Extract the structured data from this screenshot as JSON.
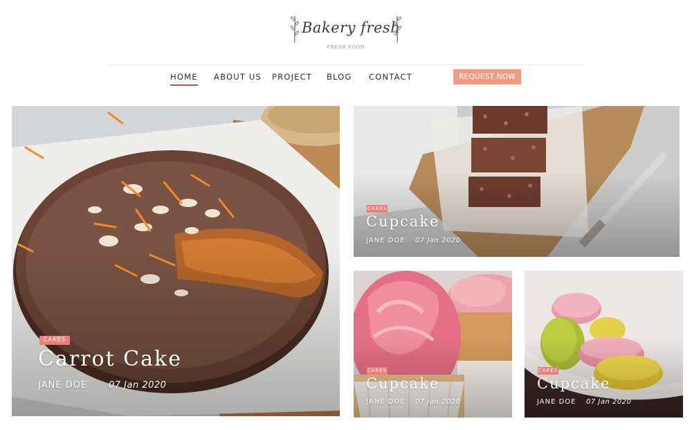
{
  "logo": {
    "script_text": "Bakery fresh",
    "tagline": "FRESH FOOD"
  },
  "nav": {
    "items": [
      {
        "label": "HOME",
        "active": true
      },
      {
        "label": "ABOUT US",
        "active": false
      },
      {
        "label": "PROJECT",
        "active": false
      },
      {
        "label": "BLOG",
        "active": false
      },
      {
        "label": "CONTACT",
        "active": false
      }
    ],
    "cta_label": "REQUEST NOW"
  },
  "colors": {
    "accent": "#c94b4b",
    "cta": "#f09a82",
    "badge": "#ef7e7a"
  },
  "posts": [
    {
      "category": "CAKES",
      "title": "Carrot Cake",
      "author": "JANE DOE",
      "date": "07 Jan 2020",
      "image": "carrot-cake-photo"
    },
    {
      "category": "CAKES",
      "title": "Cupcake",
      "author": "JANE DOE",
      "date": "07 Jan 2020",
      "image": "granola-bars-photo"
    },
    {
      "category": "CAKES",
      "title": "Cupcake",
      "author": "JANE DOE",
      "date": "07 Jan 2020",
      "image": "pink-cupcakes-photo"
    },
    {
      "category": "CAKES",
      "title": "Cupcake",
      "author": "JANE DOE",
      "date": "07 Jan 2020",
      "image": "macarons-photo"
    }
  ]
}
